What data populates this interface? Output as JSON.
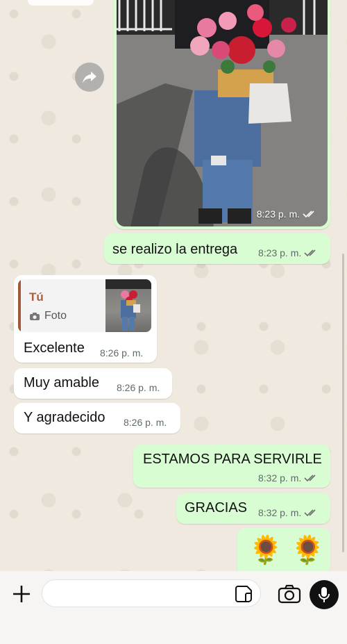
{
  "chat": {
    "photo_message": {
      "time": "8:23 p. m."
    },
    "messages_out_1": {
      "text": "se realizo la entrega",
      "time": "8:23 p. m."
    },
    "reply": {
      "quoted_author": "Tú",
      "quoted_type": "Foto",
      "text": "Excelente",
      "time": "8:26 p. m."
    },
    "msg_in_2": {
      "text": "Muy amable",
      "time": "8:26 p. m."
    },
    "msg_in_3": {
      "text": "Y agradecido",
      "time": "8:26 p. m."
    },
    "msg_out_2": {
      "text": "ESTAMOS PARA SERVIRLE",
      "time": "8:32 p. m."
    },
    "msg_out_3": {
      "text": "GRACIAS",
      "time": "8:32 p. m."
    },
    "msg_out_4": {
      "emoji": "🌻 🌻"
    }
  },
  "composer": {
    "placeholder": ""
  },
  "icons": {
    "forward": "forward-arrow-icon",
    "plus": "plus-icon",
    "sticker": "sticker-icon",
    "camera": "camera-icon",
    "mic": "microphone-icon"
  },
  "colors": {
    "outgoing_bubble": "#d9fdd3",
    "incoming_bubble": "#ffffff",
    "read_check": "#53bdeb",
    "quote_accent": "#a8603f"
  }
}
